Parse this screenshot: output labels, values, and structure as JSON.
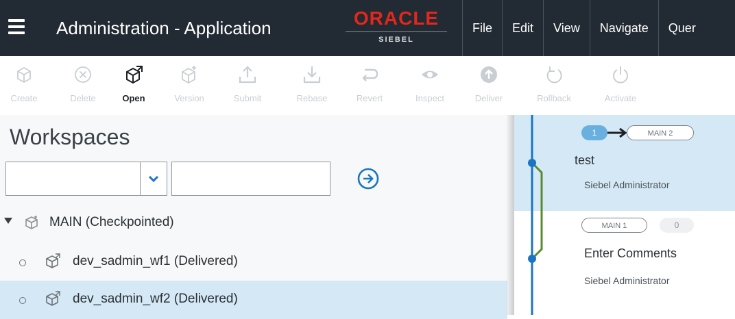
{
  "header": {
    "title": "Administration - Application",
    "logo_top": "ORACLE",
    "logo_bottom": "SIEBEL",
    "menu": [
      "File",
      "Edit",
      "View",
      "Navigate",
      "Quer"
    ]
  },
  "toolbar": {
    "items": [
      {
        "label": "Create",
        "icon": "cube-plus-icon",
        "enabled": false
      },
      {
        "label": "Delete",
        "icon": "circle-x-icon",
        "enabled": false
      },
      {
        "label": "Open",
        "icon": "cube-open-icon",
        "enabled": true
      },
      {
        "label": "Version",
        "icon": "cube-version-icon",
        "enabled": false
      },
      {
        "label": "Submit",
        "icon": "upload-icon",
        "enabled": false
      },
      {
        "label": "Rebase",
        "icon": "download-icon",
        "enabled": false
      },
      {
        "label": "Revert",
        "icon": "undo-arrow-icon",
        "enabled": false
      },
      {
        "label": "Inspect",
        "icon": "eye-icon",
        "enabled": false
      },
      {
        "label": "Deliver",
        "icon": "circle-up-arrow-icon",
        "enabled": false
      },
      {
        "label": "Rollback",
        "icon": "rollback-icon",
        "enabled": false
      },
      {
        "label": "Activate",
        "icon": "power-icon",
        "enabled": false
      }
    ]
  },
  "workspaces": {
    "title": "Workspaces",
    "filter_value": "",
    "search_value": "",
    "tree": [
      {
        "label": "MAIN (Checkpointed)",
        "level": 0,
        "expanded": true,
        "selected": false
      },
      {
        "label": "dev_sadmin_wf1 (Delivered)",
        "level": 1,
        "selected": false
      },
      {
        "label": "dev_sadmin_wf2 (Delivered)",
        "level": 1,
        "selected": true
      }
    ]
  },
  "history": {
    "entries": [
      {
        "from": "1",
        "to": "MAIN 2",
        "title": "test",
        "author": "Siebel Administrator",
        "selected": true
      },
      {
        "from": "MAIN 1",
        "to": "0",
        "title": "Enter Comments",
        "author": "Siebel Administrator",
        "selected": false
      }
    ]
  },
  "colors": {
    "header_bg": "#222a33",
    "oracle_red": "#e2271c",
    "accent_blue": "#1a75c2",
    "selection_bg": "#d4e8f5",
    "branch_green": "#5a8a2e"
  }
}
